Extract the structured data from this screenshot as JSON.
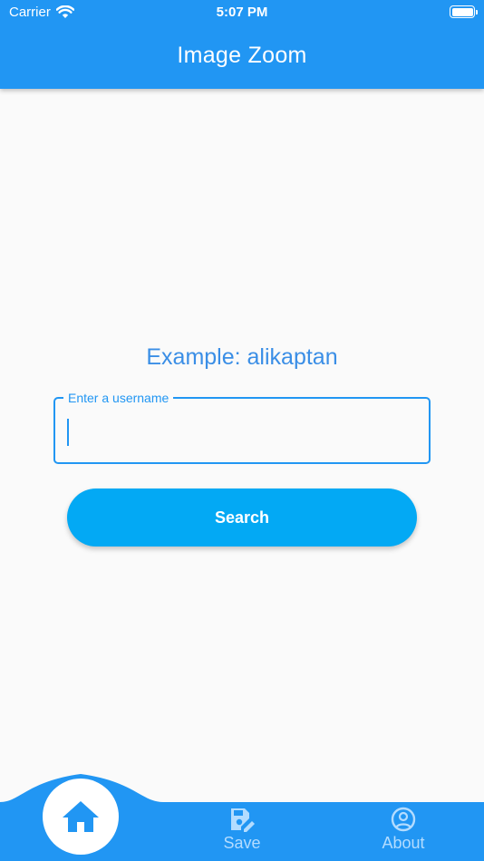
{
  "status_bar": {
    "carrier": "Carrier",
    "time": "5:07 PM"
  },
  "appbar": {
    "title": "Image Zoom"
  },
  "main": {
    "example_text": "Example: alikaptan",
    "username": {
      "label": "Enter a username",
      "value": ""
    },
    "search_label": "Search"
  },
  "bottom_nav": {
    "items": [
      {
        "label": "",
        "icon": "home-icon",
        "active": true
      },
      {
        "label": "Save",
        "icon": "save-icon",
        "active": false
      },
      {
        "label": "About",
        "icon": "account-circle-icon",
        "active": false
      }
    ]
  },
  "colors": {
    "primary": "#2196f3",
    "button": "#03a9f4",
    "background": "#fafafa",
    "inactive_nav": "#b3dcff"
  }
}
